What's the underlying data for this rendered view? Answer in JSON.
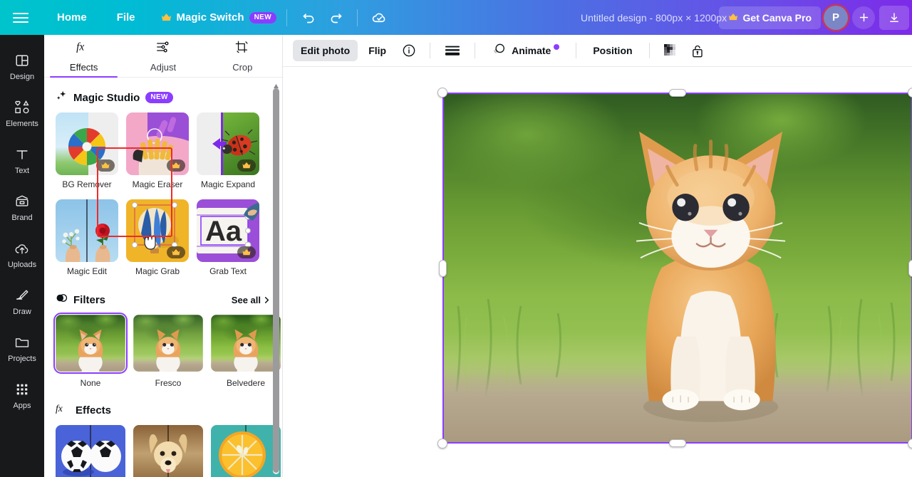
{
  "topbar": {
    "menu_icon": "hamburger-icon",
    "home_label": "Home",
    "file_label": "File",
    "magic_switch_label": "Magic Switch",
    "magic_switch_badge": "NEW",
    "undo_icon": "undo-icon",
    "redo_icon": "redo-icon",
    "saved_icon": "cloud-check-icon",
    "doc_title": "Untitled design - 800px × 1200px",
    "pro_label": "Get Canva Pro",
    "avatar_initial": "P",
    "plus_icon": "plus-icon",
    "share_icon": "download-icon",
    "gradient_start": "#00c4cc",
    "gradient_end": "#7d2ae8",
    "badge_color": "#8b3dff",
    "avatar_ring_color": "#c8365a"
  },
  "rail": {
    "items": [
      {
        "label": "Design",
        "icon": "design-icon"
      },
      {
        "label": "Elements",
        "icon": "elements-icon"
      },
      {
        "label": "Text",
        "icon": "text-icon"
      },
      {
        "label": "Brand",
        "icon": "brand-icon"
      },
      {
        "label": "Uploads",
        "icon": "uploads-cloud-icon"
      },
      {
        "label": "Draw",
        "icon": "draw-pen-icon"
      },
      {
        "label": "Projects",
        "icon": "projects-folder-icon"
      },
      {
        "label": "Apps",
        "icon": "apps-grid-icon"
      }
    ]
  },
  "panel": {
    "tabs": [
      {
        "label": "Effects",
        "icon": "fx-icon",
        "active": true
      },
      {
        "label": "Adjust",
        "icon": "sliders-icon",
        "active": false
      },
      {
        "label": "Crop",
        "icon": "crop-icon",
        "active": false
      }
    ],
    "magic_studio": {
      "title": "Magic Studio",
      "badge": "NEW",
      "icon": "sparkle-icon",
      "tools": [
        {
          "name": "BG Remover",
          "pro": true,
          "highlighted": true
        },
        {
          "name": "Magic Eraser",
          "pro": true,
          "highlighted": false
        },
        {
          "name": "Magic Expand",
          "pro": true,
          "highlighted": false
        },
        {
          "name": "Magic Edit",
          "pro": false,
          "highlighted": false
        },
        {
          "name": "Magic Grab",
          "pro": true,
          "highlighted": false
        },
        {
          "name": "Grab Text",
          "pro": true,
          "highlighted": false
        }
      ],
      "highlight_color": "#ee2b2b"
    },
    "filters": {
      "title": "Filters",
      "icon": "filters-icon",
      "see_all_label": "See all",
      "items": [
        {
          "name": "None",
          "selected": true
        },
        {
          "name": "Fresco",
          "selected": false
        },
        {
          "name": "Belvedere",
          "selected": false
        }
      ],
      "selected_color": "#8b3dff"
    },
    "effects": {
      "title": "Effects",
      "icon": "fx-icon",
      "items": [
        {
          "name": "shadow-soccer"
        },
        {
          "name": "shadow-dog"
        },
        {
          "name": "shadow-orange"
        }
      ]
    },
    "scrollbar": {
      "name": "panel-scrollbar"
    }
  },
  "editor_toolbar": {
    "edit_photo_label": "Edit photo",
    "flip_label": "Flip",
    "info_icon": "info-icon",
    "transparency_icon": "transparency-icon",
    "animate_label": "Animate",
    "animate_icon": "animate-icon",
    "animate_has_new_dot": true,
    "position_label": "Position",
    "checker_icon": "transparency-checker-icon",
    "lock_icon": "lock-open-icon"
  },
  "canvas": {
    "image_name": "orange-tabby-kitten-photo",
    "selection_color": "#8b3dff",
    "handles": [
      "top-left",
      "top-center",
      "top-right",
      "middle-left",
      "middle-right",
      "bottom-left",
      "bottom-center",
      "bottom-right"
    ]
  }
}
